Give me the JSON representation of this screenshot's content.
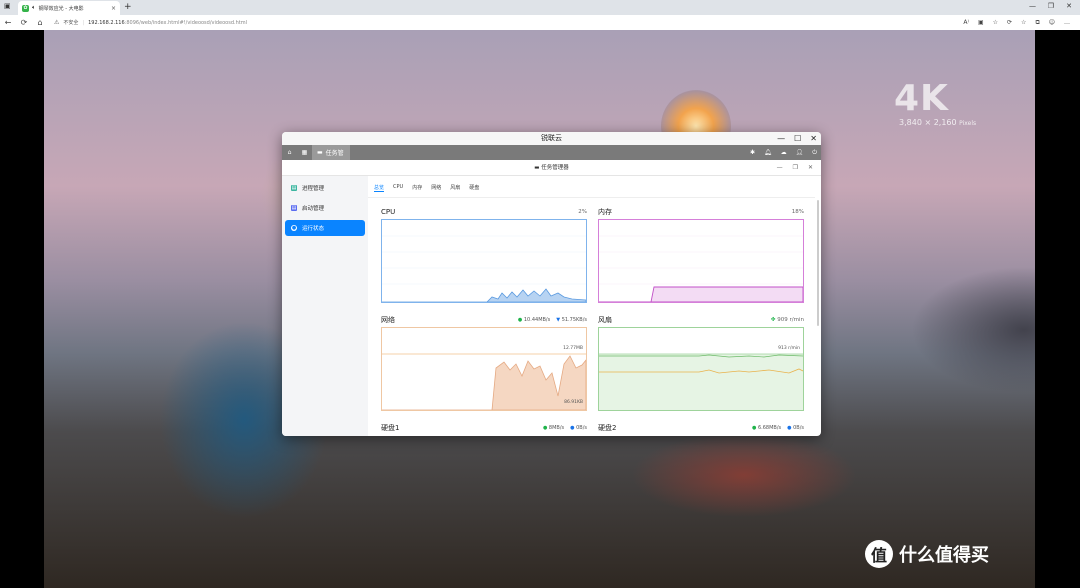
{
  "browser": {
    "tab_title": "钢琴效应光 - 大电影",
    "tab_close": "×",
    "new_tab": "+",
    "security": "不安全",
    "url_host": "192.168.2.116",
    "url_rest": ":8096/web/index.html#!/videoosd/videoosd.html",
    "window_controls": [
      "—",
      "❐",
      "✕"
    ],
    "tool_icons": [
      "A⁾",
      "▣",
      "☆",
      "⟳",
      "☆",
      "⧉",
      "…"
    ]
  },
  "video": {
    "badge_4k": "4K",
    "resolution": "3,840 × 2,160",
    "resolution_suffix": "Pixels",
    "watermark": "什么值得买",
    "watermark_badge": "值"
  },
  "app": {
    "title": "锐联云",
    "controls": [
      "—",
      "☐",
      "✕"
    ],
    "toolbar_task_label": "任务管",
    "inner_title": "任务管理器",
    "inner_controls": [
      "—",
      "❐",
      "✕"
    ],
    "sidebar": [
      {
        "label": "进程管理",
        "icon": "process-icon",
        "active": false
      },
      {
        "label": "启动管理",
        "icon": "startup-icon",
        "active": false
      },
      {
        "label": "运行状态",
        "icon": "status-icon",
        "active": true
      }
    ],
    "tabs": [
      "总览",
      "CPU",
      "内存",
      "网络",
      "风扇",
      "硬盘"
    ],
    "active_tab": 0,
    "cpu": {
      "label": "CPU",
      "value": "2%",
      "color": "#4a90e2"
    },
    "memory": {
      "label": "内存",
      "value": "18%",
      "color": "#c24fc8"
    },
    "network": {
      "label": "网络",
      "down": "10.44MB/s",
      "up": "51.75KB/s",
      "max_label": "12.77MB",
      "min_label": "86.91KB",
      "color": "#e0a57a"
    },
    "fan": {
      "label": "风扇",
      "value": "909 r/min",
      "max_label": "913 r/min",
      "color": "#7bc47a"
    },
    "disk1": {
      "label": "硬盘1",
      "read": "8MB/s",
      "write": "0B/s"
    },
    "disk2": {
      "label": "硬盘2",
      "read": "6.68MB/s",
      "write": "0B/s"
    }
  }
}
